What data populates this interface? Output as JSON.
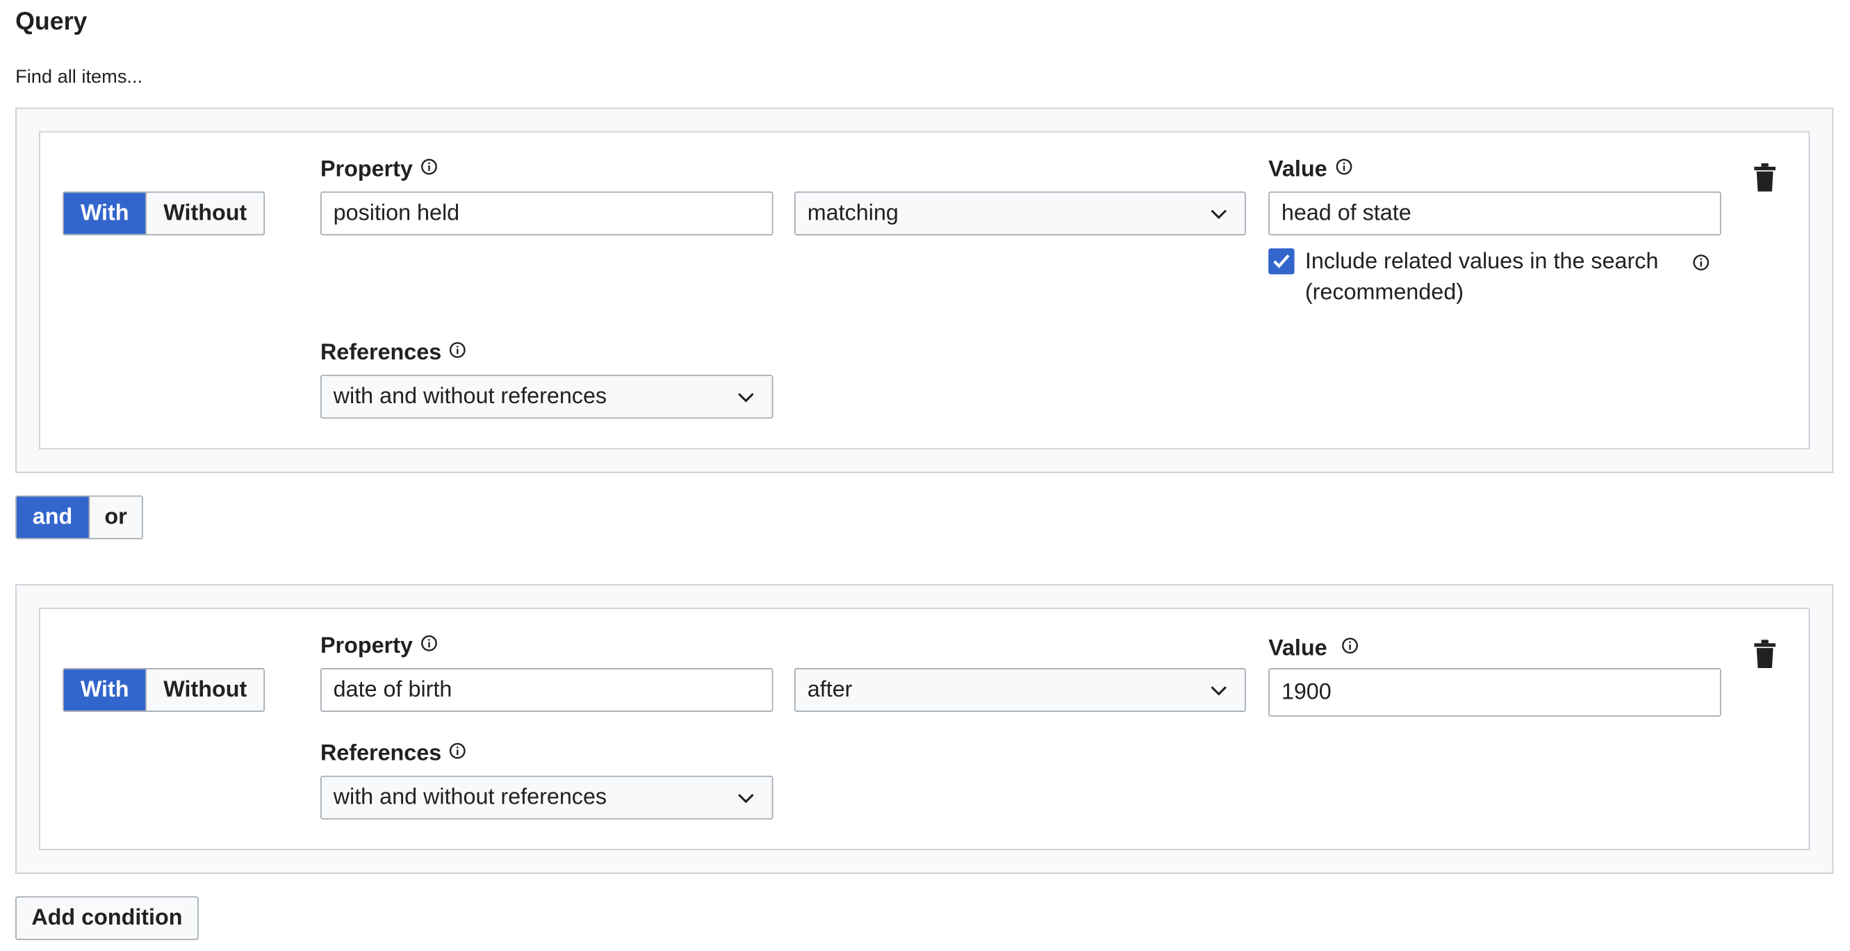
{
  "heading": "Query",
  "intro": "Find all items...",
  "conditions": [
    {
      "with_label": "With",
      "without_label": "Without",
      "active": "with",
      "property_label": "Property",
      "property_value": "position held",
      "operator": "matching",
      "value_label": "Value",
      "value": "head of state",
      "include_related": {
        "checked": true,
        "label": "Include related values in the search (recommended)"
      },
      "references_label": "References",
      "references_value": "with and without references"
    },
    {
      "with_label": "With",
      "without_label": "Without",
      "active": "with",
      "property_label": "Property",
      "property_value": "date of birth",
      "operator": "after",
      "value_label": "Value",
      "value": "1900",
      "references_label": "References",
      "references_value": "with and without references"
    }
  ],
  "conjunction": {
    "and_label": "and",
    "or_label": "or",
    "active": "and"
  },
  "add_condition_label": "Add condition",
  "colors": {
    "accent": "#3366cc",
    "border": "#a2a9b1",
    "panel_bg": "#f8f9fa"
  },
  "icons": [
    "info-icon",
    "chevron-down-icon",
    "trash-icon",
    "checkmark-icon"
  ]
}
